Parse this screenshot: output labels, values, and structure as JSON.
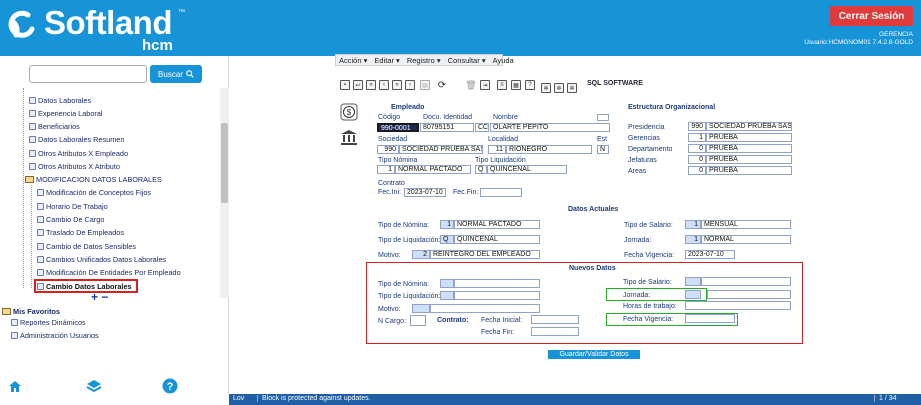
{
  "header": {
    "brand": "Softland",
    "brand_tm": "™",
    "product": "hcm",
    "logout_label": "Cerrar Sesión",
    "context_line1": "GERENCIA",
    "context_line2": "Usuario:HCMGNOM01 7.4.2.8-GOLD",
    "color": "#1793d8"
  },
  "sidebar": {
    "search_placeholder": "",
    "search_button": "Buscar",
    "items": [
      {
        "label": "Datos Laborales"
      },
      {
        "label": "Experiencia Laboral"
      },
      {
        "label": "Beneficiarios"
      },
      {
        "label": "Datos Laborales Resumen"
      },
      {
        "label": "Otros Atributos X Empleado"
      },
      {
        "label": "Otros Atributos X Atributo"
      },
      {
        "label": "MODIFICACION DATOS LABORALES"
      },
      {
        "label": "Modificación de Conceptos Fijos"
      },
      {
        "label": "Horario De Trabajo"
      },
      {
        "label": "Cambio De Cargo"
      },
      {
        "label": "Traslado De Empleados"
      },
      {
        "label": "Cambio de Datos Sensibles"
      },
      {
        "label": "Cambios Unificados Datos Laborales"
      },
      {
        "label": "Modificación De Entidades Por Empleado"
      },
      {
        "label": "Cambio Datos Laborales"
      }
    ],
    "plus": "+",
    "minus": "−",
    "favorites_title": "Mis Favoritos",
    "favorites": [
      {
        "label": "Reportes Dinámicos"
      },
      {
        "label": "Administración Usuarios"
      }
    ]
  },
  "menu": {
    "items": [
      "Acción",
      "Editar",
      "Registro",
      "Consultar",
      "Ayuda"
    ]
  },
  "toolbar": {
    "product_label": "SQL SOFTWARE"
  },
  "form": {
    "empleado_title": "Empleado",
    "org_title": "Estructura Organizacional",
    "codigo_label": "Código",
    "codigo": "990-0001",
    "docu_label": "Docu. Identidad",
    "docu": "80795151",
    "docu_tipo": "CC",
    "nombre_label": "Nombre",
    "nombre": "OLARTE  PEPITO",
    "sociedad_label": "Sociedad",
    "sociedad_code": "990",
    "sociedad": "SOCIEDAD  PRUEBA SAS",
    "localidad_label": "Localidad",
    "localidad_code": "11",
    "localidad": "RIONEGRO",
    "est_label": "Est",
    "est": "N",
    "tipo_nomina_label": "Tipo Nómina",
    "tipo_nomina_code": "1",
    "tipo_nomina": "NORMAL PACTADO",
    "tipo_liq_label": "Tipo Liquidación",
    "tipo_liq_code": "Q",
    "tipo_liq": "QUINCENAL",
    "contrato_label": "Contrato",
    "fec_ini_label": "Fec.Ini:",
    "fec_ini": "2023-07-10",
    "fec_fin_label": "Fec.Fin:",
    "fec_fin": "",
    "org": [
      {
        "label": "Presidencia",
        "code": "990",
        "value": "SOCIEDAD PRUEBA SAS"
      },
      {
        "label": "Gerencias",
        "code": "1",
        "value": "PRUEBA"
      },
      {
        "label": "Departamento",
        "code": "0",
        "value": "PRUEBA"
      },
      {
        "label": "Jefaturas",
        "code": "0",
        "value": "PRUEBA"
      },
      {
        "label": "Areas",
        "code": "0",
        "value": "PRUEBA"
      }
    ],
    "actuales_title": "Datos Actuales",
    "act_tipo_nomina_label": "Tipo de Nómina:",
    "act_tipo_nomina_code": "1",
    "act_tipo_nomina": "NORMAL PACTADO",
    "act_tipo_salario_label": "Tipo de Salario:",
    "act_tipo_salario_code": "1",
    "act_tipo_salario": "MENSUAL",
    "act_tipo_liq_label": "Tipo de Liquidación:",
    "act_tipo_liq_code": "Q",
    "act_tipo_liq": "QUINCENAL",
    "act_jornada_label": "Jornada:",
    "act_jornada_code": "1",
    "act_jornada": "NORMAL",
    "act_motivo_label": "Motivo:",
    "act_motivo_code": "2",
    "act_motivo": "REINTEGRO DEL EMPLEADO",
    "act_fecha_vig_label": "Fecha Vigencia:",
    "act_fecha_vig": "2023-07-10",
    "nuevos_title": "Nuevos Datos",
    "new_tipo_nomina_label": "Tipo de Nómina:",
    "new_tipo_salario_label": "Tipo de Salario:",
    "new_tipo_liq_label": "Tipo de Liquidación:",
    "new_jornada_label": "Jornada:",
    "new_horas_label": "Horas de trabajo:",
    "new_motivo_label": "Motivo:",
    "new_ncargo_label": "N Cargo:",
    "new_contrato_label": "Contrato:",
    "new_fecha_ini_label": "Fecha Inicial:",
    "new_fecha_fin_label": "Fecha Fin:",
    "new_fecha_vig_label": "Fecha Vigencia:",
    "save_label": "Guardar/Validar Datos"
  },
  "status": {
    "mode": "Lov",
    "message": "Block is protected against updates.",
    "record": "1 / 34"
  }
}
